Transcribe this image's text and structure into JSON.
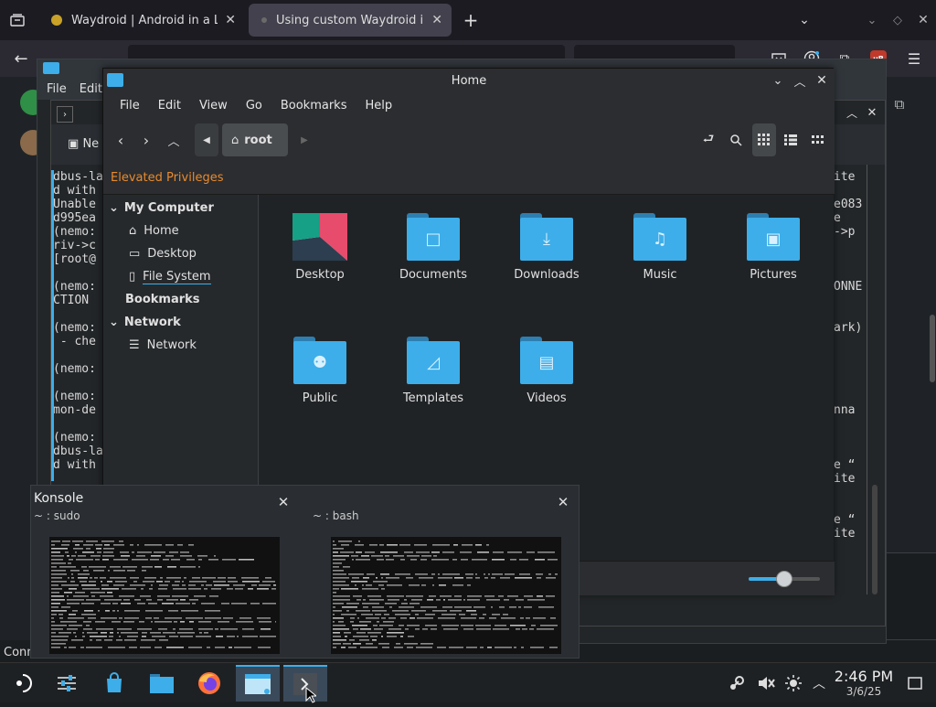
{
  "browser": {
    "tabs": [
      {
        "label": "Waydroid | Android in a Li",
        "favicon_color": "#c9a227",
        "active": false
      },
      {
        "label": "Using custom Waydroid im",
        "favicon_color": "#5a5a5a",
        "active": true
      }
    ],
    "new_tab_label": "+"
  },
  "konsole_back": {
    "menu": [
      "File",
      "Edit"
    ],
    "tab_label": "Ne",
    "terminal_left": "dbus-la\nd with\nUnable\nd995ea\n(nemo:\nriv->c\n[root@\n\n(nemo:\nCTION\n\n(nemo:\n - che\n\n(nemo:\n\n(nemo:\nmon-de\n\n(nemo:\ndbus-la\nd with",
    "terminal_right": "ite\n\ne083\ne\n->p\n\n\n\nONNE\n\n\nark)\n\n\n\n\n\nnna\n\n\n\ne “\nite\n\n\ne “\nite",
    "status_fragment": "Conn"
  },
  "nemo": {
    "title": "Home",
    "menu": [
      "File",
      "Edit",
      "View",
      "Go",
      "Bookmarks",
      "Help"
    ],
    "location": "root",
    "privileges_label": "Elevated Privileges",
    "sidebar": {
      "my_computer": "My Computer",
      "items": [
        "Home",
        "Desktop",
        "File System"
      ],
      "bookmarks": "Bookmarks",
      "network_header": "Network",
      "network_item": "Network"
    },
    "files": [
      {
        "name": "Desktop",
        "kind": "desktop"
      },
      {
        "name": "Documents",
        "kind": "folder",
        "glyph": "□"
      },
      {
        "name": "Downloads",
        "kind": "folder",
        "glyph": "⤓"
      },
      {
        "name": "Music",
        "kind": "folder",
        "glyph": "♫"
      },
      {
        "name": "Pictures",
        "kind": "folder",
        "glyph": "▣"
      },
      {
        "name": "Public",
        "kind": "folder",
        "glyph": "⚉"
      },
      {
        "name": "Templates",
        "kind": "folder",
        "glyph": "◿"
      },
      {
        "name": "Videos",
        "kind": "folder",
        "glyph": "▤"
      }
    ],
    "zoom_level": 0.5
  },
  "switcher": {
    "app_name": "Konsole",
    "windows": [
      {
        "title": "~ : sudo"
      },
      {
        "title": "~ : bash"
      }
    ]
  },
  "taskbar": {
    "time": "2:46 PM",
    "date": "3/6/25"
  },
  "colors": {
    "accent": "#3daee9",
    "privileges": "#e98a2d",
    "folder": "#3daee9"
  }
}
